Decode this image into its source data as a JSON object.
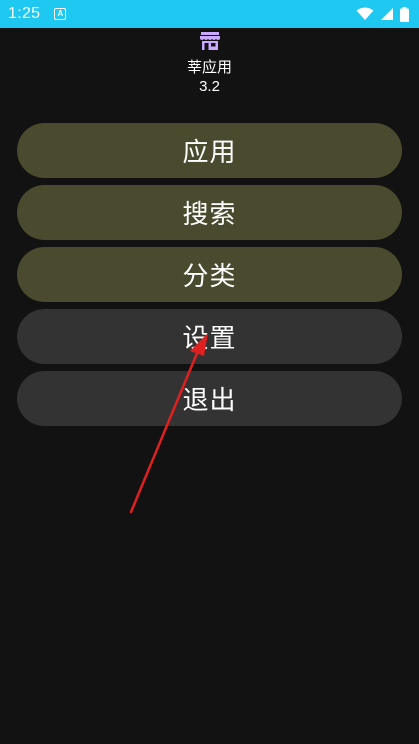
{
  "status_bar": {
    "time": "1:25",
    "notification_letter": "A",
    "icons": [
      "wifi-icon",
      "signal-icon",
      "battery-icon"
    ],
    "background": "#1ec8f0"
  },
  "app": {
    "name": "莘应用",
    "version": "3.2",
    "logo_icon": "store-icon",
    "logo_color": "#c9a8ff"
  },
  "menu": {
    "items": [
      {
        "label": "应用",
        "color": "#4a4a2f"
      },
      {
        "label": "搜索",
        "color": "#4a4a2f"
      },
      {
        "label": "分类",
        "color": "#4a4a2f"
      },
      {
        "label": "设置",
        "color": "#333333"
      },
      {
        "label": "退出",
        "color": "#333333"
      }
    ]
  },
  "annotation": {
    "type": "arrow",
    "color": "#e02020",
    "points_to": "设置"
  }
}
